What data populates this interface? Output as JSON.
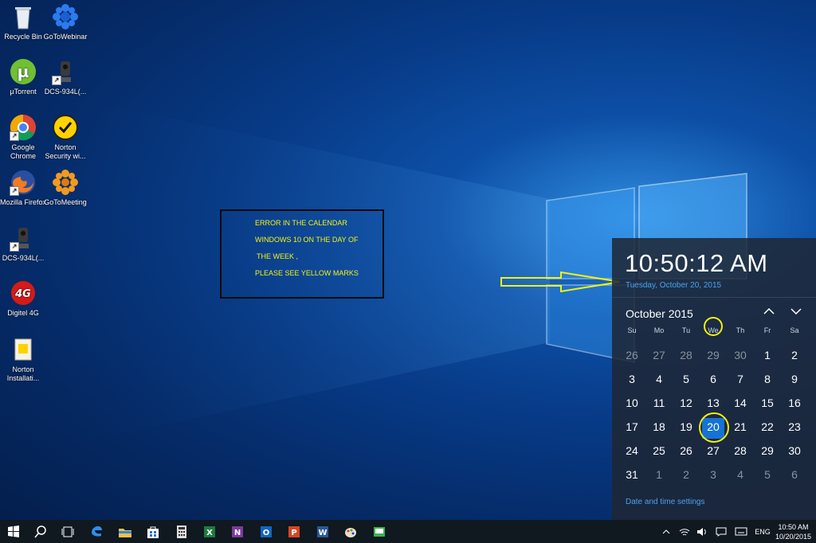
{
  "desktop_icons": [
    {
      "label": "Recycle Bin",
      "icon": "recycle-bin-icon"
    },
    {
      "label": "GoToWebinar",
      "icon": "gotowebinar-icon"
    },
    {
      "label": "µTorrent",
      "icon": "utorrent-icon"
    },
    {
      "label": "DCS-934L(...",
      "icon": "webcam-icon"
    },
    {
      "label": "Google Chrome",
      "icon": "chrome-icon"
    },
    {
      "label": "Norton Security wi...",
      "icon": "norton-icon"
    },
    {
      "label": "Mozilla Firefox",
      "icon": "firefox-icon"
    },
    {
      "label": "GoToMeeting",
      "icon": "gotomeeting-icon"
    },
    {
      "label": "DCS-934L(...",
      "icon": "webcam-icon"
    },
    {
      "label": "Digitel 4G",
      "icon": "digitel-icon"
    },
    {
      "label": "Norton Installati...",
      "icon": "installer-icon"
    }
  ],
  "annotation": {
    "line1": "ERROR IN THE CALENDAR",
    "line2": "WINDOWS 10 ON THE DAY OF",
    "line3": "THE WEEK ,",
    "line4": "PLEASE SEE YELLOW MARKS"
  },
  "flyout": {
    "time": "10:50:12 AM",
    "date": "Tuesday, October 20, 2015",
    "month": "October 2015",
    "weekdays": [
      "Su",
      "Mo",
      "Tu",
      "We",
      "Th",
      "Fr",
      "Sa"
    ],
    "weeks": [
      [
        "26",
        "27",
        "28",
        "29",
        "30",
        "1",
        "2"
      ],
      [
        "3",
        "4",
        "5",
        "6",
        "7",
        "8",
        "9"
      ],
      [
        "10",
        "11",
        "12",
        "13",
        "14",
        "15",
        "16"
      ],
      [
        "17",
        "18",
        "19",
        "20",
        "21",
        "22",
        "23"
      ],
      [
        "24",
        "25",
        "26",
        "27",
        "28",
        "29",
        "30"
      ],
      [
        "31",
        "1",
        "2",
        "3",
        "4",
        "5",
        "6"
      ]
    ],
    "selected_day": "20",
    "settings_link": "Date and time settings"
  },
  "taskbar": {
    "apps": [
      "start-icon",
      "search-icon",
      "task-view-icon",
      "edge-icon",
      "file-explorer-icon",
      "store-icon",
      "calculator-icon",
      "excel-icon",
      "onenote-icon",
      "outlook-icon",
      "powerpoint-icon",
      "word-icon",
      "paint-icon",
      "mail-app-icon"
    ],
    "lang": "ENG",
    "time": "10:50 AM",
    "date": "10/20/2015"
  },
  "colors": {
    "accent": "#1672d4",
    "link": "#4aa3f0",
    "annotation_yellow": "#f4f411"
  }
}
